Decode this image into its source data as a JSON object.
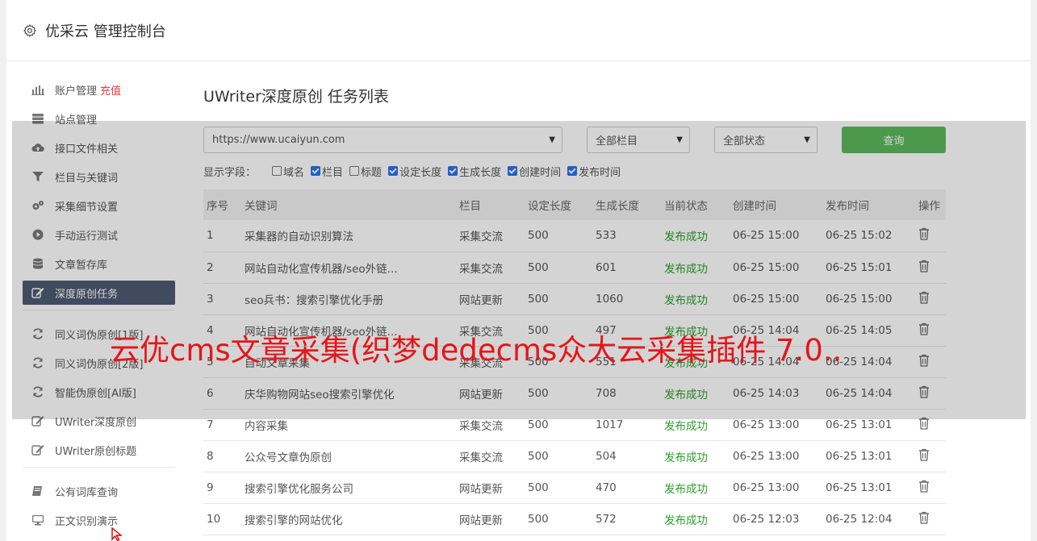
{
  "header": {
    "title": "优采云 管理控制台"
  },
  "sidebar": {
    "group1": [
      {
        "label": "账户管理",
        "extra": "充值",
        "icon": "bar-chart-icon"
      },
      {
        "label": "站点管理",
        "icon": "server-icon"
      },
      {
        "label": "接口文件相关",
        "icon": "cloud-upload-icon"
      },
      {
        "label": "栏目与关键词",
        "icon": "filter-icon"
      },
      {
        "label": "采集细节设置",
        "icon": "gears-icon"
      },
      {
        "label": "手动运行测试",
        "icon": "play-circle-icon"
      },
      {
        "label": "文章暂存库",
        "icon": "database-icon"
      },
      {
        "label": "深度原创任务",
        "icon": "edit-icon",
        "active": true
      }
    ],
    "group2": [
      {
        "label": "同义词伪原创[1版]",
        "icon": "refresh-icon"
      },
      {
        "label": "同义词伪原创[2版]",
        "icon": "refresh-icon"
      },
      {
        "label": "智能伪原创[AI版]",
        "icon": "refresh-icon"
      },
      {
        "label": "UWriter深度原创",
        "icon": "edit-icon"
      },
      {
        "label": "UWriter原创标题",
        "icon": "edit-icon"
      }
    ],
    "group3": [
      {
        "label": "公有词库查询",
        "icon": "book-icon"
      },
      {
        "label": "正文识别演示",
        "icon": "monitor-icon"
      }
    ]
  },
  "main": {
    "title": "UWriter深度原创 任务列表",
    "filters": {
      "site": "https://www.ucaiyun.com",
      "column": "全部栏目",
      "status": "全部状态",
      "query_button": "查询"
    },
    "fields_label": "显示字段：",
    "fields": [
      {
        "label": "域名",
        "checked": false
      },
      {
        "label": "栏目",
        "checked": true
      },
      {
        "label": "标题",
        "checked": false
      },
      {
        "label": "设定长度",
        "checked": true
      },
      {
        "label": "生成长度",
        "checked": true
      },
      {
        "label": "创建时间",
        "checked": true
      },
      {
        "label": "发布时间",
        "checked": true
      }
    ],
    "table": {
      "headers": [
        "序号",
        "关键词",
        "栏目",
        "设定长度",
        "生成长度",
        "当前状态",
        "创建时间",
        "发布时间",
        "操作"
      ],
      "rows": [
        [
          "1",
          "采集器的自动识别算法",
          "采集交流",
          "500",
          "533",
          "发布成功",
          "06-25 15:00",
          "06-25 15:02"
        ],
        [
          "2",
          "网站自动化宣传机器/seo外链...",
          "采集交流",
          "500",
          "601",
          "发布成功",
          "06-25 15:00",
          "06-25 15:01"
        ],
        [
          "3",
          "seo兵书：搜索引擎优化手册",
          "网站更新",
          "500",
          "1060",
          "发布成功",
          "06-25 15:00",
          "06-25 15:00"
        ],
        [
          "4",
          "网站自动化宣传机器/seo外链...",
          "采集交流",
          "500",
          "497",
          "发布成功",
          "06-25 14:04",
          "06-25 14:05"
        ],
        [
          "5",
          "自动文章采集",
          "采集交流",
          "500",
          "551",
          "发布成功",
          "06-25 14:04",
          "06-25 14:04"
        ],
        [
          "6",
          "庆华购物网站seo搜索引擎优化",
          "网站更新",
          "500",
          "708",
          "发布成功",
          "06-25 14:03",
          "06-25 14:04"
        ],
        [
          "7",
          "内容采集",
          "采集交流",
          "500",
          "1017",
          "发布成功",
          "06-25 13:00",
          "06-25 13:01"
        ],
        [
          "8",
          "公众号文章伪原创",
          "采集交流",
          "500",
          "504",
          "发布成功",
          "06-25 13:00",
          "06-25 13:01"
        ],
        [
          "9",
          "搜索引擎优化服务公司",
          "网站更新",
          "500",
          "470",
          "发布成功",
          "06-25 13:00",
          "06-25 13:01"
        ],
        [
          "10",
          "搜索引擎的网站优化",
          "网站更新",
          "500",
          "572",
          "发布成功",
          "06-25 12:03",
          "06-25 12:04"
        ]
      ]
    }
  },
  "banner": {
    "text": "云优cms文章采集(织梦dedecms众大云采集插件 7.0.."
  },
  "colors": {
    "accent_green": "#5cb85c",
    "active_nav": "#4f5b73",
    "status_green": "#2a9d2a",
    "banner_red": "#e4161b"
  }
}
